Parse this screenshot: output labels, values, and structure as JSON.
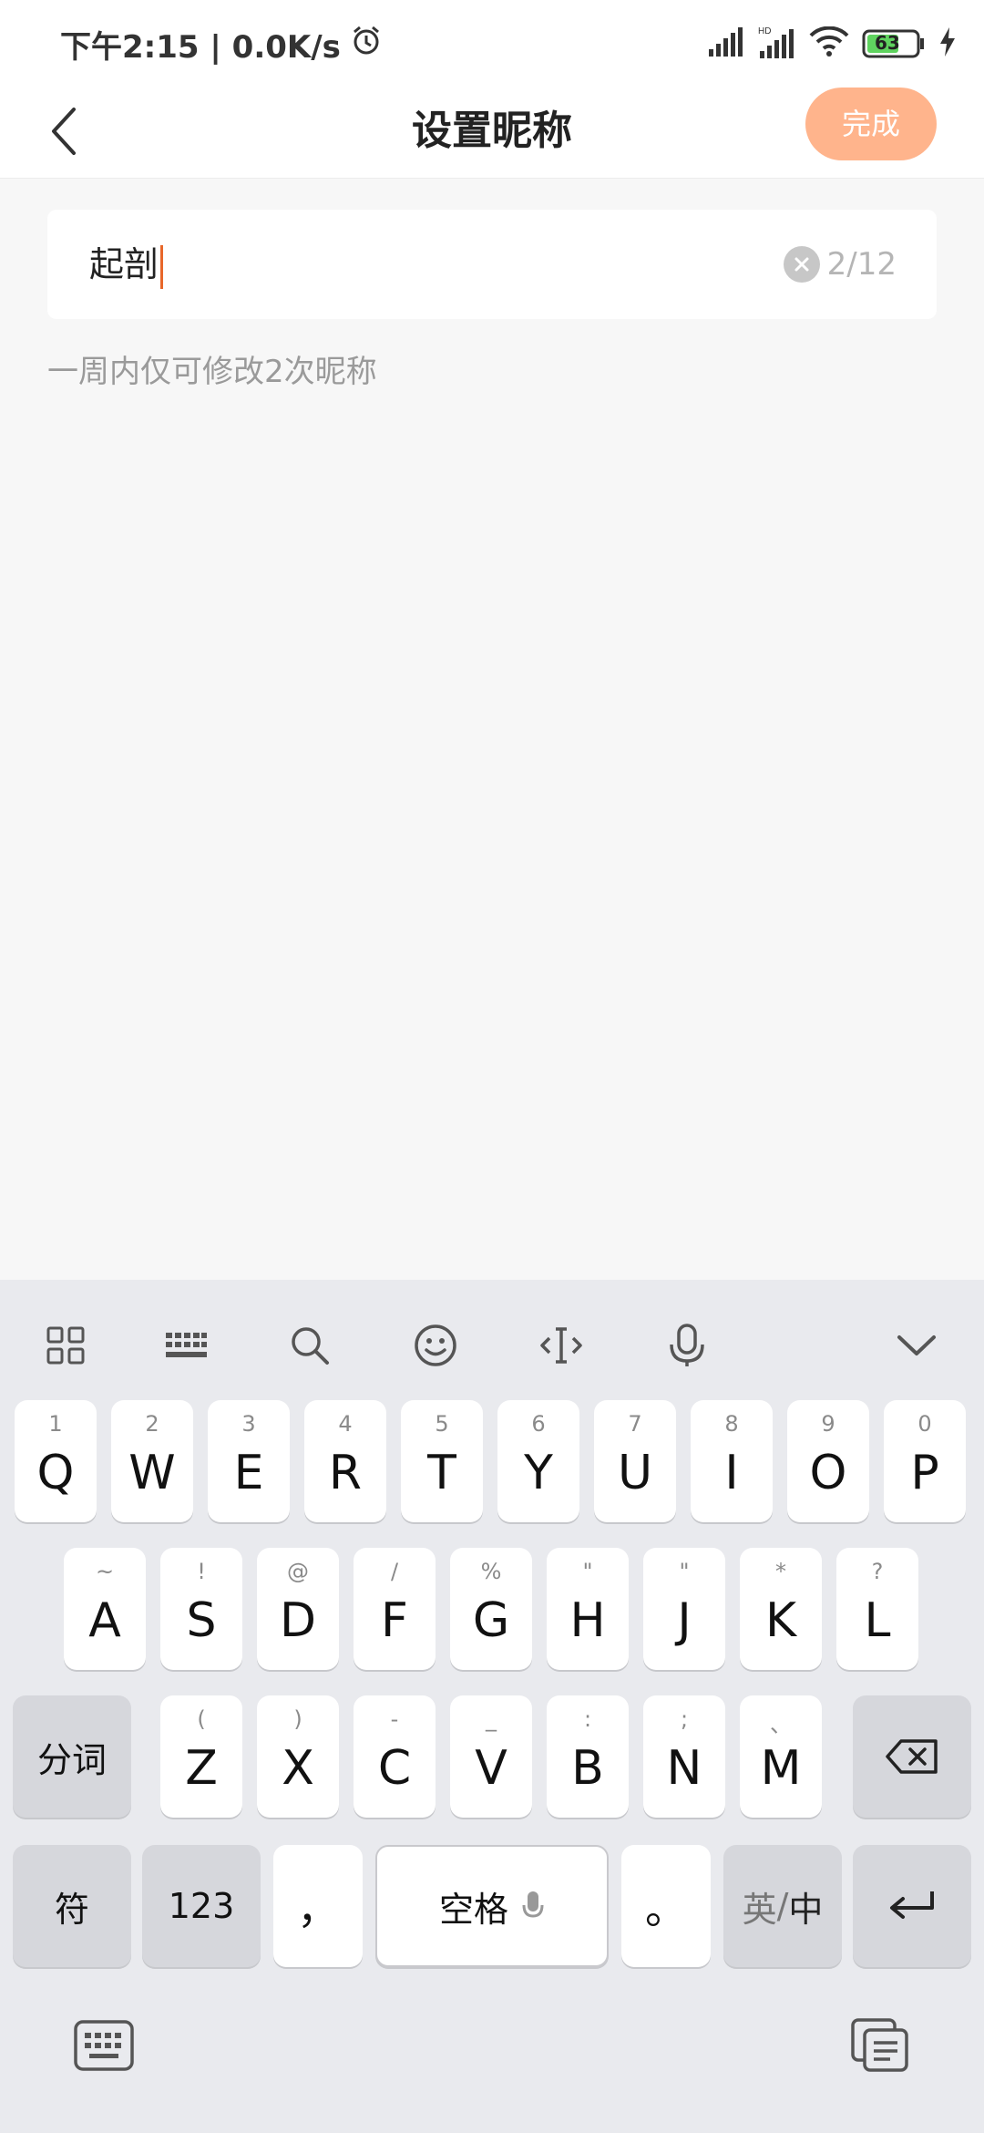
{
  "status": {
    "time_text": "下午2:15 | 0.0K/s",
    "battery": "63"
  },
  "nav": {
    "title": "设置昵称",
    "done_label": "完成"
  },
  "input": {
    "value": "起剖",
    "counter": "2/12"
  },
  "hint": "一周内仅可修改2次昵称",
  "colors": {
    "accent": "#e8672a",
    "done_bg": "#ffb48c",
    "battery_green": "#5fd35f"
  },
  "keyboard": {
    "toolbar_icons": [
      "grid-icon",
      "keyboard-layout-icon",
      "search-icon",
      "emoji-icon",
      "cursor-icon",
      "mic-icon",
      "chevron-down-icon"
    ],
    "row1": [
      {
        "k": "Q",
        "s": "1"
      },
      {
        "k": "W",
        "s": "2"
      },
      {
        "k": "E",
        "s": "3"
      },
      {
        "k": "R",
        "s": "4"
      },
      {
        "k": "T",
        "s": "5"
      },
      {
        "k": "Y",
        "s": "6"
      },
      {
        "k": "U",
        "s": "7"
      },
      {
        "k": "I",
        "s": "8"
      },
      {
        "k": "O",
        "s": "9"
      },
      {
        "k": "P",
        "s": "0"
      }
    ],
    "row2": [
      {
        "k": "A",
        "s": "~"
      },
      {
        "k": "S",
        "s": "!"
      },
      {
        "k": "D",
        "s": "@"
      },
      {
        "k": "F",
        "s": "/"
      },
      {
        "k": "G",
        "s": "%"
      },
      {
        "k": "H",
        "s": "\""
      },
      {
        "k": "J",
        "s": "\""
      },
      {
        "k": "K",
        "s": "*"
      },
      {
        "k": "L",
        "s": "?"
      }
    ],
    "row3": [
      {
        "k": "Z",
        "s": "("
      },
      {
        "k": "X",
        "s": ")"
      },
      {
        "k": "C",
        "s": "-"
      },
      {
        "k": "V",
        "s": "_"
      },
      {
        "k": "B",
        "s": ":"
      },
      {
        "k": "N",
        "s": ";"
      },
      {
        "k": "M",
        "s": "、"
      }
    ],
    "fenci": "分词",
    "fu": "符",
    "num": "123",
    "comma": "，",
    "space": "空格",
    "period": "。",
    "lang_en": "英",
    "lang_sep": "/",
    "lang_zh": "中"
  }
}
